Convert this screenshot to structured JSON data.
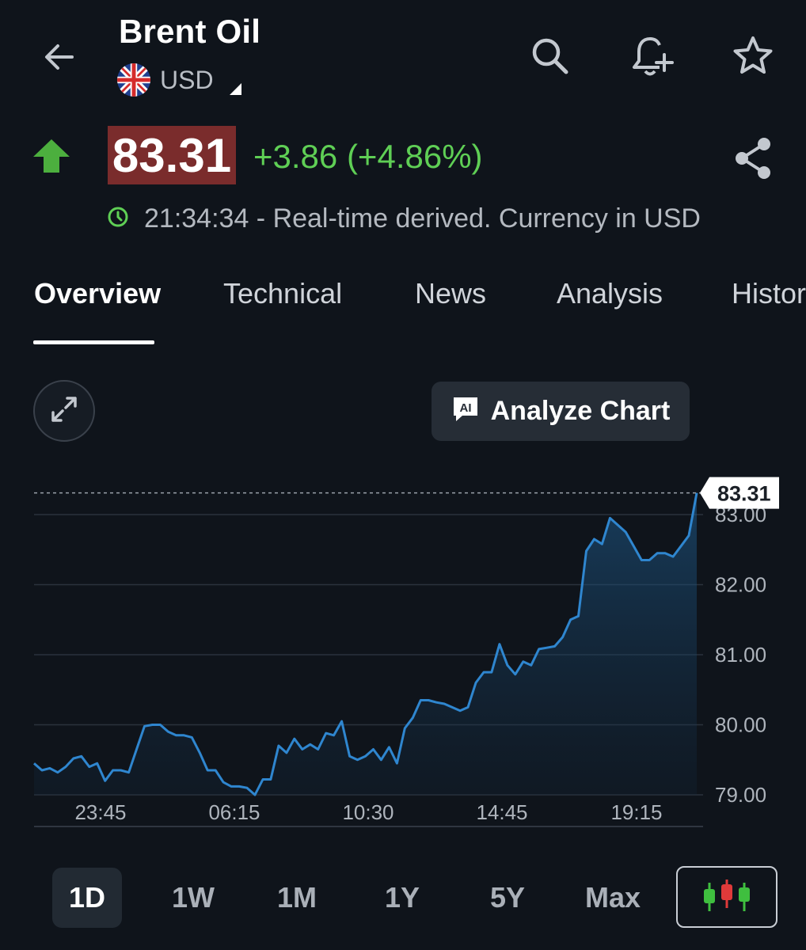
{
  "header": {
    "title": "Brent Oil",
    "currency": "USD",
    "icons": [
      "back-arrow-icon",
      "uk-flag-icon",
      "search-icon",
      "add-alert-bell-icon",
      "star-icon"
    ]
  },
  "quote": {
    "price": "83.31",
    "change": "+3.86 (+4.86%)",
    "timestamp_text": "21:34:34 - Real-time derived. Currency in USD",
    "direction_icon": "up-arrow-icon",
    "share_icon": "share-icon",
    "colors": {
      "up": "#5fcf55",
      "price_highlight": "#7a2c2c"
    }
  },
  "tabs": [
    {
      "label": "Overview",
      "active": true
    },
    {
      "label": "Technical"
    },
    {
      "label": "News"
    },
    {
      "label": "Analysis"
    },
    {
      "label": "Histor"
    }
  ],
  "chart_toolbar": {
    "expand_icon": "expand-icon",
    "analyze_label": "Analyze Chart",
    "analyze_icon": "ai-icon"
  },
  "chart_data": {
    "type": "area",
    "title": "",
    "xlabel": "",
    "ylabel": "",
    "x_tick_labels": [
      "23:45",
      "06:15",
      "10:30",
      "14:45",
      "19:15"
    ],
    "y_ticks": [
      79.0,
      80.0,
      81.0,
      82.0,
      83.0
    ],
    "y_tick_labels": [
      "79.00",
      "80.00",
      "81.00",
      "82.00",
      "83.00"
    ],
    "ylim": [
      79.0,
      83.3
    ],
    "last_value_label": "83.31",
    "last_value": 83.31,
    "grid": true,
    "line_color": "#2f86cf",
    "series": [
      {
        "values": [
          79.45,
          79.35,
          79.38,
          79.32,
          79.4,
          79.52,
          79.55,
          79.4,
          79.45,
          79.2,
          79.35,
          79.35,
          79.32,
          79.65,
          79.98,
          80.0,
          80.0,
          79.9,
          79.85,
          79.85,
          79.82,
          79.6,
          79.35,
          79.35,
          79.18,
          79.12,
          79.12,
          79.1,
          79.0,
          79.22,
          79.22,
          79.7,
          79.6,
          79.8,
          79.65,
          79.72,
          79.65,
          79.88,
          79.85,
          80.05,
          79.55,
          79.5,
          79.55,
          79.65,
          79.5,
          79.68,
          79.45,
          79.95,
          80.1,
          80.35,
          80.35,
          80.32,
          80.3,
          80.25,
          80.2,
          80.25,
          80.6,
          80.75,
          80.75,
          81.15,
          80.85,
          80.72,
          80.9,
          80.85,
          81.08,
          81.1,
          81.12,
          81.25,
          81.5,
          81.55,
          82.48,
          82.65,
          82.58,
          82.95,
          82.85,
          82.75,
          82.55,
          82.35,
          82.35,
          82.45,
          82.45,
          82.4,
          82.55,
          82.7,
          83.31
        ]
      }
    ]
  },
  "ranges": [
    {
      "label": "1D",
      "active": true
    },
    {
      "label": "1W"
    },
    {
      "label": "1M"
    },
    {
      "label": "1Y"
    },
    {
      "label": "5Y"
    },
    {
      "label": "Max"
    }
  ],
  "candlestick_toggle_icon": "candlestick-icon"
}
